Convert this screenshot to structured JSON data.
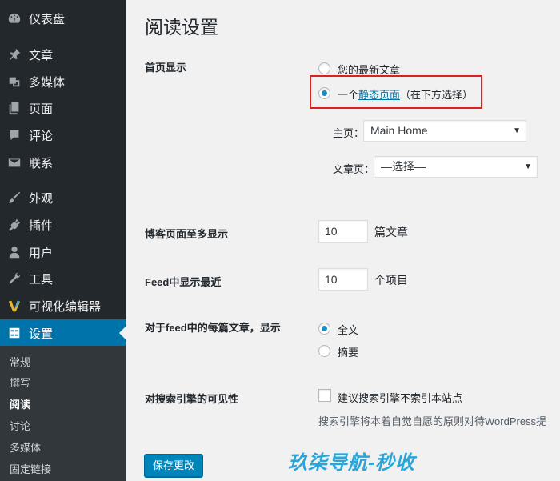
{
  "sidebar": {
    "items": [
      {
        "label": "仪表盘",
        "icon": "dashboard-icon"
      },
      {
        "label": "文章",
        "icon": "pin-icon"
      },
      {
        "label": "多媒体",
        "icon": "media-icon"
      },
      {
        "label": "页面",
        "icon": "pages-icon"
      },
      {
        "label": "评论",
        "icon": "comments-icon"
      },
      {
        "label": "联系",
        "icon": "mail-icon"
      },
      {
        "label": "外观",
        "icon": "brush-icon"
      },
      {
        "label": "插件",
        "icon": "plugin-icon"
      },
      {
        "label": "用户",
        "icon": "user-icon"
      },
      {
        "label": "工具",
        "icon": "wrench-icon"
      },
      {
        "label": "可视化编辑器",
        "icon": "visual-composer-icon"
      },
      {
        "label": "设置",
        "icon": "settings-icon"
      }
    ],
    "submenu": [
      "常规",
      "撰写",
      "阅读",
      "讨论",
      "多媒体",
      "固定链接"
    ],
    "current_submenu": "阅读"
  },
  "page": {
    "title": "阅读设置",
    "front_page": {
      "label": "首页显示",
      "option_latest": "您的最新文章",
      "option_static_prefix": "一个",
      "option_static_link": "静态页面",
      "option_static_suffix": "（在下方选择）",
      "selected": "static",
      "homepage_label": "主页：",
      "homepage_value": "Main Home",
      "postspage_label": "文章页：",
      "postspage_value": "—选择—"
    },
    "posts_per_page": {
      "label": "博客页面至多显示",
      "value": "10",
      "unit": "篇文章"
    },
    "feed_recent": {
      "label": "Feed中显示最近",
      "value": "10",
      "unit": "个项目"
    },
    "feed_article": {
      "label": "对于feed中的每篇文章，显示",
      "option_full": "全文",
      "option_summary": "摘要",
      "selected": "full"
    },
    "search_visibility": {
      "label": "对搜索引擎的可见性",
      "checkbox_label": "建议搜索引擎不索引本站点",
      "checked": false,
      "description": "搜索引擎将本着自觉自愿的原则对待WordPress提"
    },
    "save_label": "保存更改"
  },
  "watermark": "玖柒导航-秒收",
  "colors": {
    "sidebar": "#23282d",
    "accent": "#0073aa",
    "highlight_border": "#d9221f",
    "watermark": "#1a9fd8"
  }
}
